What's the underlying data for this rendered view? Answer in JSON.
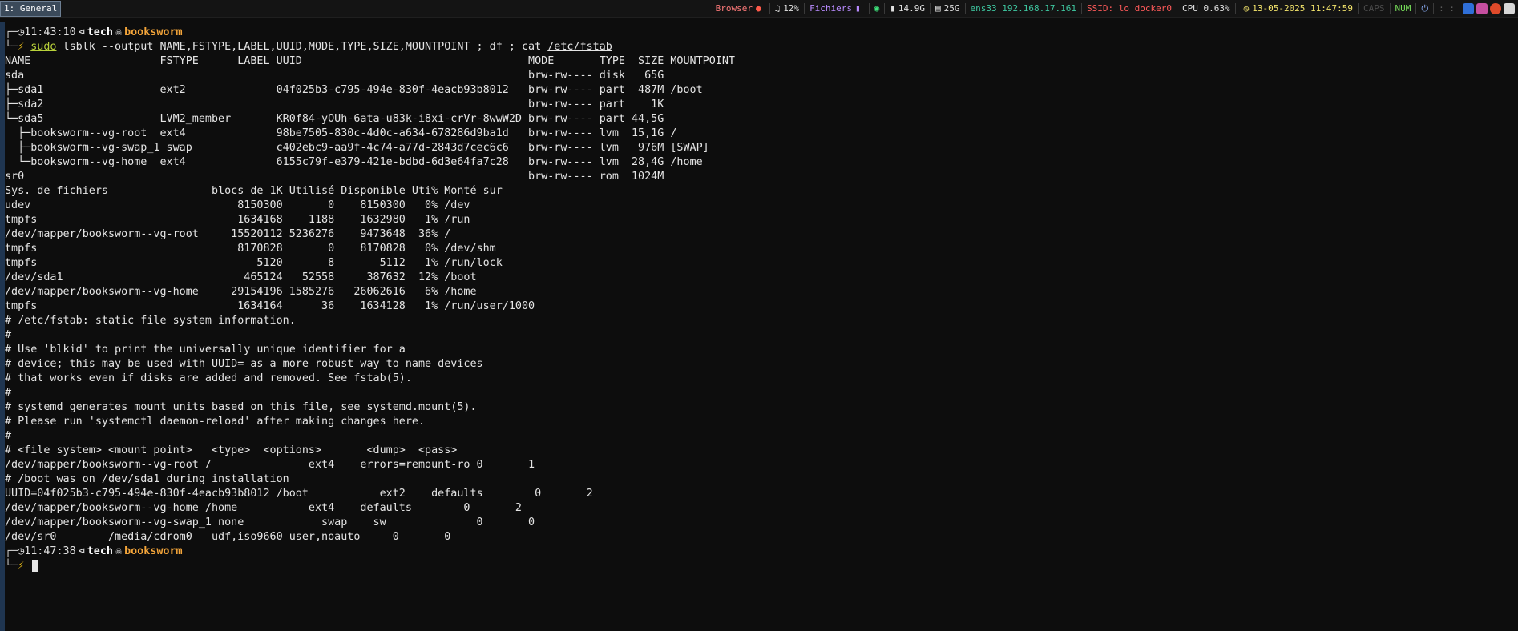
{
  "workspace": {
    "label": "1: General"
  },
  "status_bar": {
    "browser": {
      "label": "Browser",
      "color": "#ff7a7a"
    },
    "volume": {
      "label": "12%"
    },
    "files": {
      "label": "Fichiers",
      "color": "#b98bff"
    },
    "net_indicator": {
      "color": "#3ee07a"
    },
    "memory": {
      "label": "14.9G"
    },
    "disk": {
      "label": "25G"
    },
    "ethernet": {
      "label": "ens33 192.168.17.161",
      "color": "#3ec7a0"
    },
    "wifi": {
      "label": "SSID:  lo docker0",
      "color": "#ff5a5a"
    },
    "cpu": {
      "label": "CPU 0.63%"
    },
    "datetime": {
      "label": "13-05-2025 11:47:59",
      "color": "#f2e36b"
    },
    "caps": {
      "label": "CAPS",
      "color": "#4a4a4a"
    },
    "num": {
      "label": "NUM",
      "color": "#78e05a"
    },
    "menu": {
      "label": ": :"
    }
  },
  "terminal": {
    "prompt1": {
      "time": "11:43:10",
      "user": "tech",
      "host": "booksworm"
    },
    "command": {
      "sudo": "sudo",
      "body": " lsblk --output NAME,FSTYPE,LABEL,UUID,MODE,TYPE,SIZE,MOUNTPOINT ; df ; cat ",
      "path": "/etc/fstab"
    },
    "output": [
      "NAME                    FSTYPE      LABEL UUID                                   MODE       TYPE  SIZE MOUNTPOINT",
      "sda                                                                              brw-rw---- disk   65G ",
      "├─sda1                  ext2              04f025b3-c795-494e-830f-4eacb93b8012   brw-rw---- part  487M /boot",
      "├─sda2                                                                           brw-rw---- part    1K ",
      "└─sda5                  LVM2_member       KR0f84-yOUh-6ata-u83k-i8xi-crVr-8wwW2D brw-rw---- part 44,5G ",
      "  ├─booksworm--vg-root  ext4              98be7505-830c-4d0c-a634-678286d9ba1d   brw-rw---- lvm  15,1G /",
      "  ├─booksworm--vg-swap_1 swap             c402ebc9-aa9f-4c74-a77d-2843d7cec6c6   brw-rw---- lvm   976M [SWAP]",
      "  └─booksworm--vg-home  ext4              6155c79f-e379-421e-bdbd-6d3e64fa7c28   brw-rw---- lvm  28,4G /home",
      "sr0                                                                              brw-rw---- rom  1024M ",
      "Sys. de fichiers                blocs de 1K Utilisé Disponible Uti% Monté sur",
      "udev                                8150300       0    8150300   0% /dev",
      "tmpfs                               1634168    1188    1632980   1% /run",
      "/dev/mapper/booksworm--vg-root     15520112 5236276    9473648  36% /",
      "tmpfs                               8170828       0    8170828   0% /dev/shm",
      "tmpfs                                  5120       8       5112   1% /run/lock",
      "/dev/sda1                            465124   52558     387632  12% /boot",
      "/dev/mapper/booksworm--vg-home     29154196 1585276   26062616   6% /home",
      "tmpfs                               1634164      36    1634128   1% /run/user/1000",
      "# /etc/fstab: static file system information.",
      "#",
      "# Use 'blkid' to print the universally unique identifier for a",
      "# device; this may be used with UUID= as a more robust way to name devices",
      "# that works even if disks are added and removed. See fstab(5).",
      "#",
      "# systemd generates mount units based on this file, see systemd.mount(5).",
      "# Please run 'systemctl daemon-reload' after making changes here.",
      "#",
      "# <file system> <mount point>   <type>  <options>       <dump>  <pass>",
      "/dev/mapper/booksworm--vg-root /               ext4    errors=remount-ro 0       1",
      "# /boot was on /dev/sda1 during installation",
      "UUID=04f025b3-c795-494e-830f-4eacb93b8012 /boot           ext2    defaults        0       2",
      "/dev/mapper/booksworm--vg-home /home           ext4    defaults        0       2",
      "/dev/mapper/booksworm--vg-swap_1 none            swap    sw              0       0",
      "/dev/sr0        /media/cdrom0   udf,iso9660 user,noauto     0       0"
    ],
    "prompt2": {
      "time": "11:47:38",
      "user": "tech",
      "host": "booksworm"
    }
  }
}
